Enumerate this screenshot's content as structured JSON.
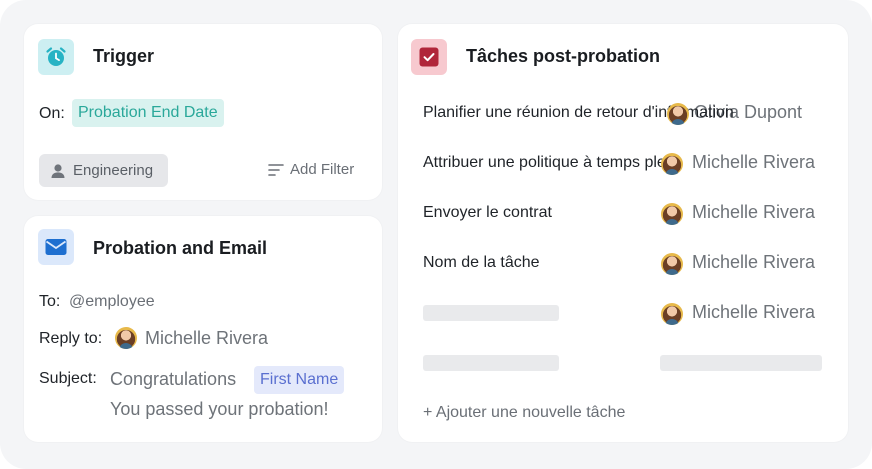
{
  "trigger": {
    "title": "Trigger",
    "icon": "alarm-clock-icon",
    "icon_color": "#27b3c4",
    "on_label": "On:",
    "on_value": "Probation End Date",
    "filter_chip": "Engineering",
    "add_filter": "Add Filter"
  },
  "email": {
    "title": "Probation and Email",
    "icon": "envelope-icon",
    "icon_color": "#1e6fd0",
    "to_label": "To:",
    "to_value": "@employee",
    "reply_label": "Reply to:",
    "reply_value": "Michelle Rivera",
    "subject_label": "Subject:",
    "subject_value": "Congratulations",
    "subject_token": "First Name",
    "subject_line2": "You passed your probation!"
  },
  "tasks": {
    "title": "Tâches post-probation",
    "icon": "checkbox-icon",
    "icon_color": "#b0263a",
    "rows": [
      {
        "name": "Planifier une réunion de retour d'information",
        "assignee": "Olivia Dupont"
      },
      {
        "name": "Attribuer une politique à temps plein",
        "assignee": "Michelle Rivera"
      },
      {
        "name": "Envoyer le contrat",
        "assignee": "Michelle Rivera"
      },
      {
        "name": "Nom de la tâche",
        "assignee": "Michelle Rivera"
      },
      {
        "name": "",
        "assignee": "Michelle Rivera"
      }
    ],
    "add_task": "+ Ajouter une nouvelle tâche"
  }
}
